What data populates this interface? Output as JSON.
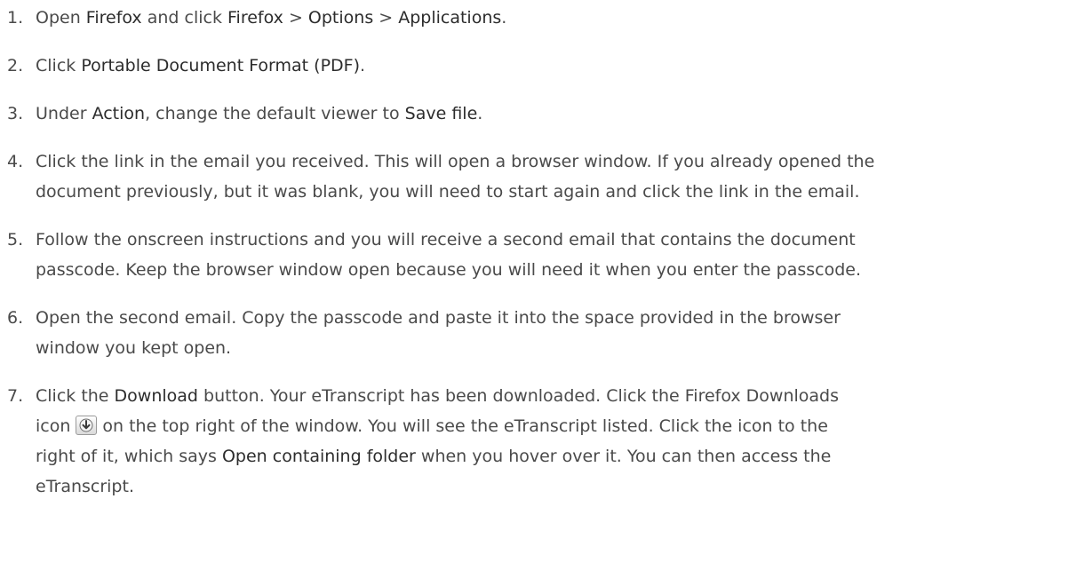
{
  "steps": [
    {
      "number": "1.",
      "lines": [
        [
          {
            "t": "Open ",
            "hl": false
          },
          {
            "t": "Firefox",
            "hl": true
          },
          {
            "t": " and click ",
            "hl": false
          },
          {
            "t": "Firefox",
            "hl": true
          },
          {
            "t": " > ",
            "hl": false
          },
          {
            "t": "Options",
            "hl": true
          },
          {
            "t": " > ",
            "hl": false
          },
          {
            "t": "Applications",
            "hl": true
          },
          {
            "t": ".",
            "hl": false
          }
        ]
      ]
    },
    {
      "number": "2.",
      "lines": [
        [
          {
            "t": "Click ",
            "hl": false
          },
          {
            "t": "Portable Document Format (PDF)",
            "hl": true
          },
          {
            "t": ".",
            "hl": false
          }
        ]
      ]
    },
    {
      "number": "3.",
      "lines": [
        [
          {
            "t": "Under ",
            "hl": false
          },
          {
            "t": "Action",
            "hl": true
          },
          {
            "t": ", change the default viewer to ",
            "hl": false
          },
          {
            "t": "Save file",
            "hl": true
          },
          {
            "t": ".",
            "hl": false
          }
        ]
      ]
    },
    {
      "number": "4.",
      "lines": [
        [
          {
            "t": "Click the link in the email you received. This will open a browser window. If you already opened the",
            "hl": false
          }
        ],
        [
          {
            "t": "document previously, but it was blank, you will need to start again and click the link in the email.",
            "hl": false
          }
        ]
      ]
    },
    {
      "number": "5.",
      "lines": [
        [
          {
            "t": "Follow the onscreen instructions and you will receive a second email that contains the document",
            "hl": false
          }
        ],
        [
          {
            "t": "passcode. Keep the browser window open because you will need it when you enter the passcode.",
            "hl": false
          }
        ]
      ]
    },
    {
      "number": "6.",
      "lines": [
        [
          {
            "t": "Open the second email. Copy the passcode and paste it into the space provided in the browser",
            "hl": false
          }
        ],
        [
          {
            "t": "window you kept open.",
            "hl": false
          }
        ]
      ]
    },
    {
      "number": "7.",
      "lines": [
        [
          {
            "t": "Click the ",
            "hl": false
          },
          {
            "t": "Download",
            "hl": true
          },
          {
            "t": " button. Your eTranscript has been downloaded. Click the Firefox Downloads",
            "hl": false
          }
        ],
        [
          {
            "t": "icon",
            "hl": false
          },
          {
            "icon": "download-arrow-icon"
          },
          {
            "t": "on the top right of the window. You will see the eTranscript listed. Click the icon to the",
            "hl": false
          }
        ],
        [
          {
            "t": "right of it, which says ",
            "hl": false
          },
          {
            "t": "Open containing folder",
            "hl": true
          },
          {
            "t": " when you hover over it. You can then access the",
            "hl": false
          }
        ],
        [
          {
            "t": "eTranscript.",
            "hl": false
          }
        ]
      ]
    }
  ]
}
